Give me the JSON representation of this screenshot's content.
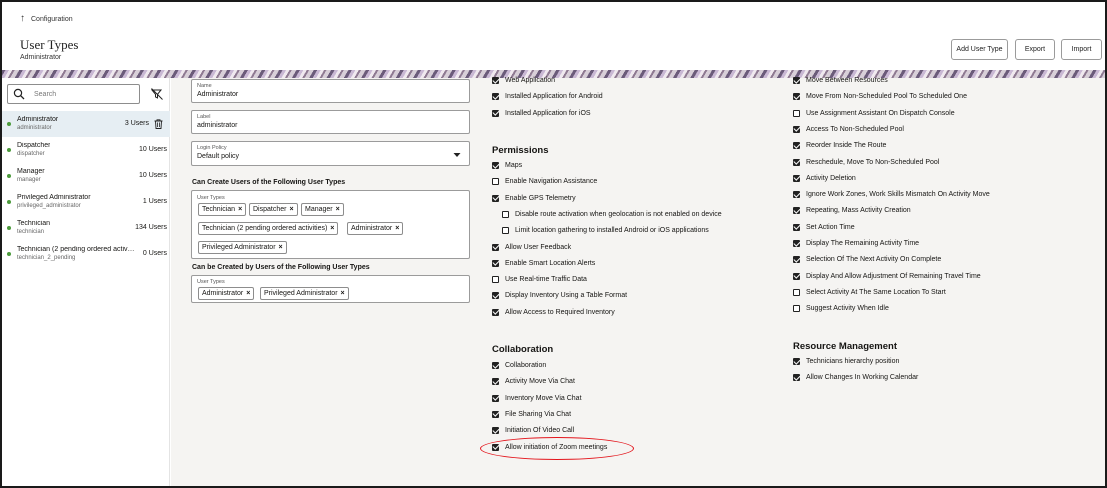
{
  "header": {
    "back_label": "Configuration",
    "title": "User Types",
    "subtitle": "Administrator",
    "buttons": {
      "add": "Add User Type",
      "export": "Export",
      "import": "Import"
    }
  },
  "sidebar": {
    "search_placeholder": "Search",
    "items": [
      {
        "name": "Administrator",
        "label": "administrator",
        "count": "3 Users"
      },
      {
        "name": "Dispatcher",
        "label": "dispatcher",
        "count": "10 Users"
      },
      {
        "name": "Manager",
        "label": "manager",
        "count": "10 Users"
      },
      {
        "name": "Privileged Administrator",
        "label": "privileged_administrator",
        "count": "1 Users"
      },
      {
        "name": "Technician",
        "label": "technician",
        "count": "134 Users"
      },
      {
        "name": "Technician (2 pending ordered activiti...",
        "label": "technician_2_pending",
        "count": "0 Users"
      }
    ]
  },
  "form": {
    "name": {
      "label": "Name",
      "value": "Administrator"
    },
    "label": {
      "label": "Label",
      "value": "administrator"
    },
    "login_policy": {
      "label": "Login Policy",
      "value": "Default policy"
    },
    "can_create": {
      "title": "Can Create Users of the Following User Types",
      "field_label": "User Types",
      "chips": [
        "Technician",
        "Dispatcher",
        "Manager",
        "Technician (2 pending ordered activities)",
        "Administrator",
        "Privileged Administrator"
      ]
    },
    "created_by": {
      "title": "Can be Created by Users of the Following User Types",
      "field_label": "User Types",
      "chips": [
        "Administrator",
        "Privileged Administrator"
      ]
    }
  },
  "col2_top": [
    {
      "label": "Web Application",
      "checked": true
    },
    {
      "label": "Installed Application for Android",
      "checked": true
    },
    {
      "label": "Installed Application for iOS",
      "checked": true
    }
  ],
  "permissions": {
    "title": "Permissions",
    "items": [
      {
        "label": "Maps",
        "checked": true
      },
      {
        "label": "Enable Navigation Assistance",
        "checked": false
      },
      {
        "label": "Enable GPS Telemetry",
        "checked": true
      },
      {
        "label": "Disable route activation when geolocation is not enabled on device",
        "checked": false
      },
      {
        "label": "Limit location gathering to installed Android or iOS applications",
        "checked": false
      },
      {
        "label": "Allow User Feedback",
        "checked": true
      },
      {
        "label": "Enable Smart Location Alerts",
        "checked": true
      },
      {
        "label": "Use Real-time Traffic Data",
        "checked": false
      },
      {
        "label": "Display Inventory Using a Table Format",
        "checked": true
      },
      {
        "label": "Allow Access to Required Inventory",
        "checked": true
      }
    ]
  },
  "collaboration": {
    "title": "Collaboration",
    "items": [
      {
        "label": "Collaboration",
        "checked": true
      },
      {
        "label": "Activity Move Via Chat",
        "checked": true
      },
      {
        "label": "Inventory Move Via Chat",
        "checked": true
      },
      {
        "label": "File Sharing Via Chat",
        "checked": true
      },
      {
        "label": "Initiation Of Video Call",
        "checked": true
      },
      {
        "label": "Allow initiation of Zoom meetings",
        "checked": true
      }
    ]
  },
  "col3": {
    "items": [
      {
        "label": "Move Between Resources",
        "checked": true
      },
      {
        "label": "Move From Non-Scheduled Pool To Scheduled One",
        "checked": true
      },
      {
        "label": "Use Assignment Assistant On Dispatch Console",
        "checked": false
      },
      {
        "label": "Access To Non-Scheduled Pool",
        "checked": true
      },
      {
        "label": "Reorder Inside The Route",
        "checked": true
      },
      {
        "label": "Reschedule, Move To Non-Scheduled Pool",
        "checked": true
      },
      {
        "label": "Activity Deletion",
        "checked": true
      },
      {
        "label": "Ignore Work Zones, Work Skills Mismatch On Activity Move",
        "checked": true
      },
      {
        "label": "Repeating, Mass Activity Creation",
        "checked": true
      },
      {
        "label": "Set Action Time",
        "checked": true
      },
      {
        "label": "Display The Remaining Activity Time",
        "checked": true
      },
      {
        "label": "Selection Of The Next Activity On Complete",
        "checked": true
      },
      {
        "label": "Display And Allow Adjustment Of Remaining Travel Time",
        "checked": true
      },
      {
        "label": "Select Activity At The Same Location To Start",
        "checked": false
      },
      {
        "label": "Suggest Activity When Idle",
        "checked": false
      }
    ]
  },
  "resource_management": {
    "title": "Resource Management",
    "items": [
      {
        "label": "Technicians hierarchy position",
        "checked": true
      },
      {
        "label": "Allow Changes In Working Calendar",
        "checked": true
      }
    ]
  }
}
